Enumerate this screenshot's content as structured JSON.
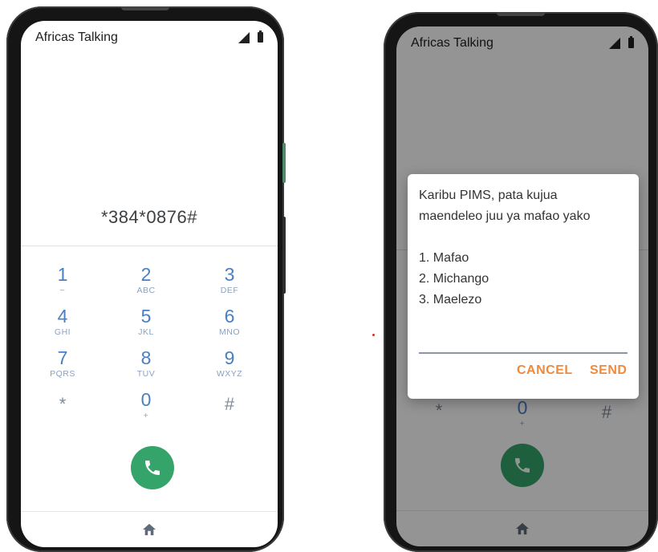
{
  "colors": {
    "key_digit": "#4a7fc1",
    "call_button": "#34a46a",
    "dialog_action": "#f08a3e"
  },
  "dialer": {
    "app_title": "Africas Talking",
    "dialed_code": "*384*0876#",
    "keys": [
      {
        "num": "1",
        "sub": "~"
      },
      {
        "num": "2",
        "sub": "ABC"
      },
      {
        "num": "3",
        "sub": "DEF"
      },
      {
        "num": "4",
        "sub": "GHI"
      },
      {
        "num": "5",
        "sub": "JKL"
      },
      {
        "num": "6",
        "sub": "MNO"
      },
      {
        "num": "7",
        "sub": "PQRS"
      },
      {
        "num": "8",
        "sub": "TUV"
      },
      {
        "num": "9",
        "sub": "WXYZ"
      },
      {
        "num": "*",
        "sub": ""
      },
      {
        "num": "0",
        "sub": "+"
      },
      {
        "num": "#",
        "sub": ""
      }
    ],
    "call_icon": "phone-icon",
    "nav_icon": "home-icon"
  },
  "ussd": {
    "app_title": "Africas Talking",
    "background_keys": {
      "star": "*",
      "zero": "0",
      "plus": "+",
      "hash": "#"
    },
    "message_lines": [
      "Karibu PIMS, pata kujua",
      "maendeleo juu ya mafao yako",
      "",
      "1. Mafao",
      "2. Michango",
      "3. Maelezo"
    ],
    "input_value": "",
    "cancel_label": "CANCEL",
    "send_label": "SEND"
  }
}
